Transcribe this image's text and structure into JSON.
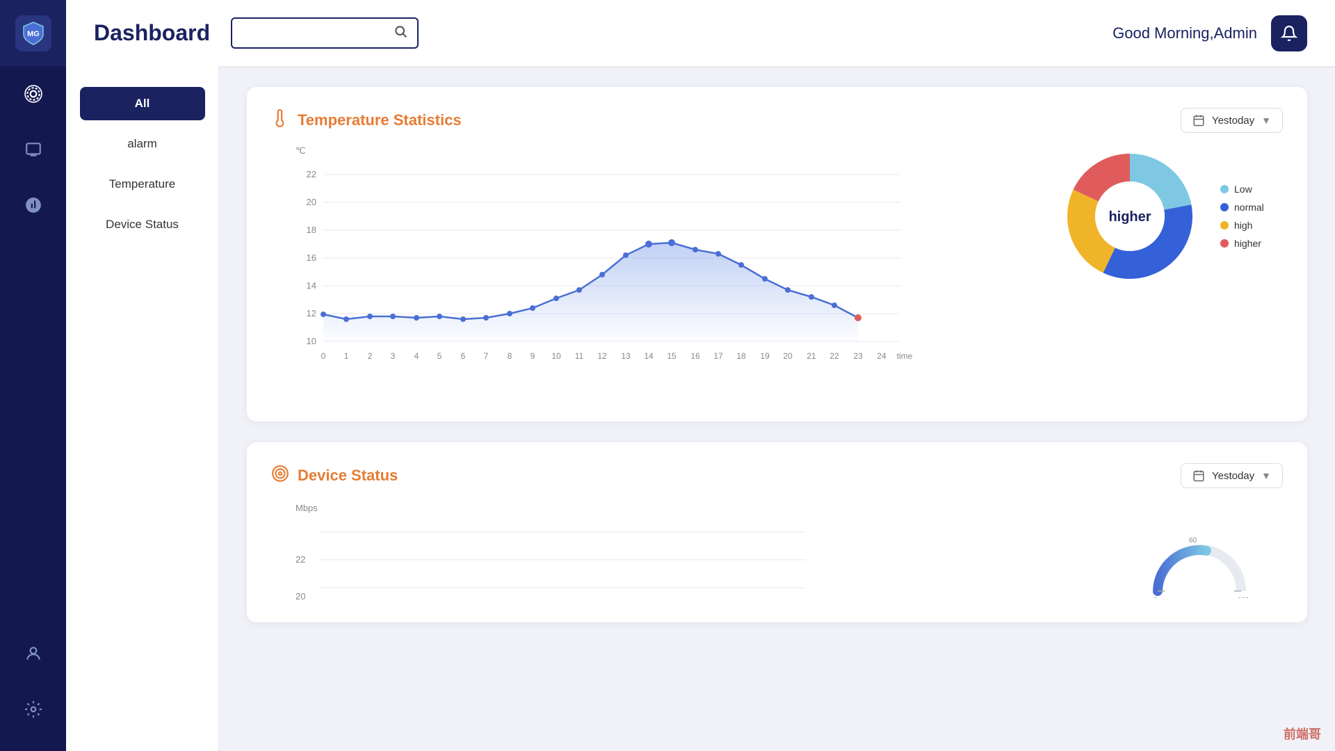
{
  "app": {
    "logo_text": "MG",
    "title": "Dashboard",
    "search_placeholder": "",
    "greeting": "Good Morning,Admin"
  },
  "sidebar": {
    "icons": [
      {
        "name": "camera-icon",
        "symbol": "📷"
      },
      {
        "name": "printer-icon",
        "symbol": "🖨"
      },
      {
        "name": "chart-icon",
        "symbol": "📊"
      },
      {
        "name": "user-icon",
        "symbol": "👤"
      },
      {
        "name": "settings-icon",
        "symbol": "⚙"
      }
    ]
  },
  "left_nav": {
    "items": [
      {
        "label": "All",
        "active": true
      },
      {
        "label": "alarm",
        "active": false
      },
      {
        "label": "Temperature",
        "active": false
      },
      {
        "label": "Device Status",
        "active": false
      }
    ]
  },
  "temperature_card": {
    "title": "Temperature Statistics",
    "dropdown_label": "Yestoday",
    "y_axis_unit": "℃",
    "x_axis_label": "time",
    "y_values": [
      22,
      20,
      18,
      16,
      14,
      12,
      10
    ],
    "x_values": [
      "0",
      "1",
      "2",
      "3",
      "4",
      "5",
      "6",
      "7",
      "8",
      "9",
      "10",
      "11",
      "12",
      "13",
      "14",
      "15",
      "16",
      "17",
      "18",
      "19",
      "20",
      "21",
      "22",
      "23",
      "24"
    ],
    "line_data": [
      11.5,
      11.2,
      11.4,
      11.4,
      11.3,
      11.4,
      11.2,
      11.3,
      11.6,
      12.0,
      12.8,
      13.4,
      14.5,
      16.0,
      18.2,
      18.5,
      17.5,
      16.8,
      15.5,
      14.2,
      13.2,
      12.5,
      11.8,
      10.5
    ],
    "donut": {
      "center_label": "higher",
      "segments": [
        {
          "label": "Low",
          "color": "#7ec8e3",
          "percent": 22
        },
        {
          "label": "normal",
          "color": "#3460d8",
          "percent": 35
        },
        {
          "label": "high",
          "color": "#f0b429",
          "percent": 25
        },
        {
          "label": "higher",
          "color": "#e05c5c",
          "percent": 18
        }
      ]
    }
  },
  "device_card": {
    "title": "Device Status",
    "dropdown_label": "Yestoday",
    "y_axis_unit": "Mbps",
    "y_values": [
      22,
      20
    ]
  },
  "colors": {
    "primary": "#1a2260",
    "accent": "#e67c35",
    "line": "#4a6fd4",
    "line_fill_start": "rgba(100,140,230,0.35)",
    "line_fill_end": "rgba(100,140,230,0.02)"
  },
  "watermark": "前端哥"
}
